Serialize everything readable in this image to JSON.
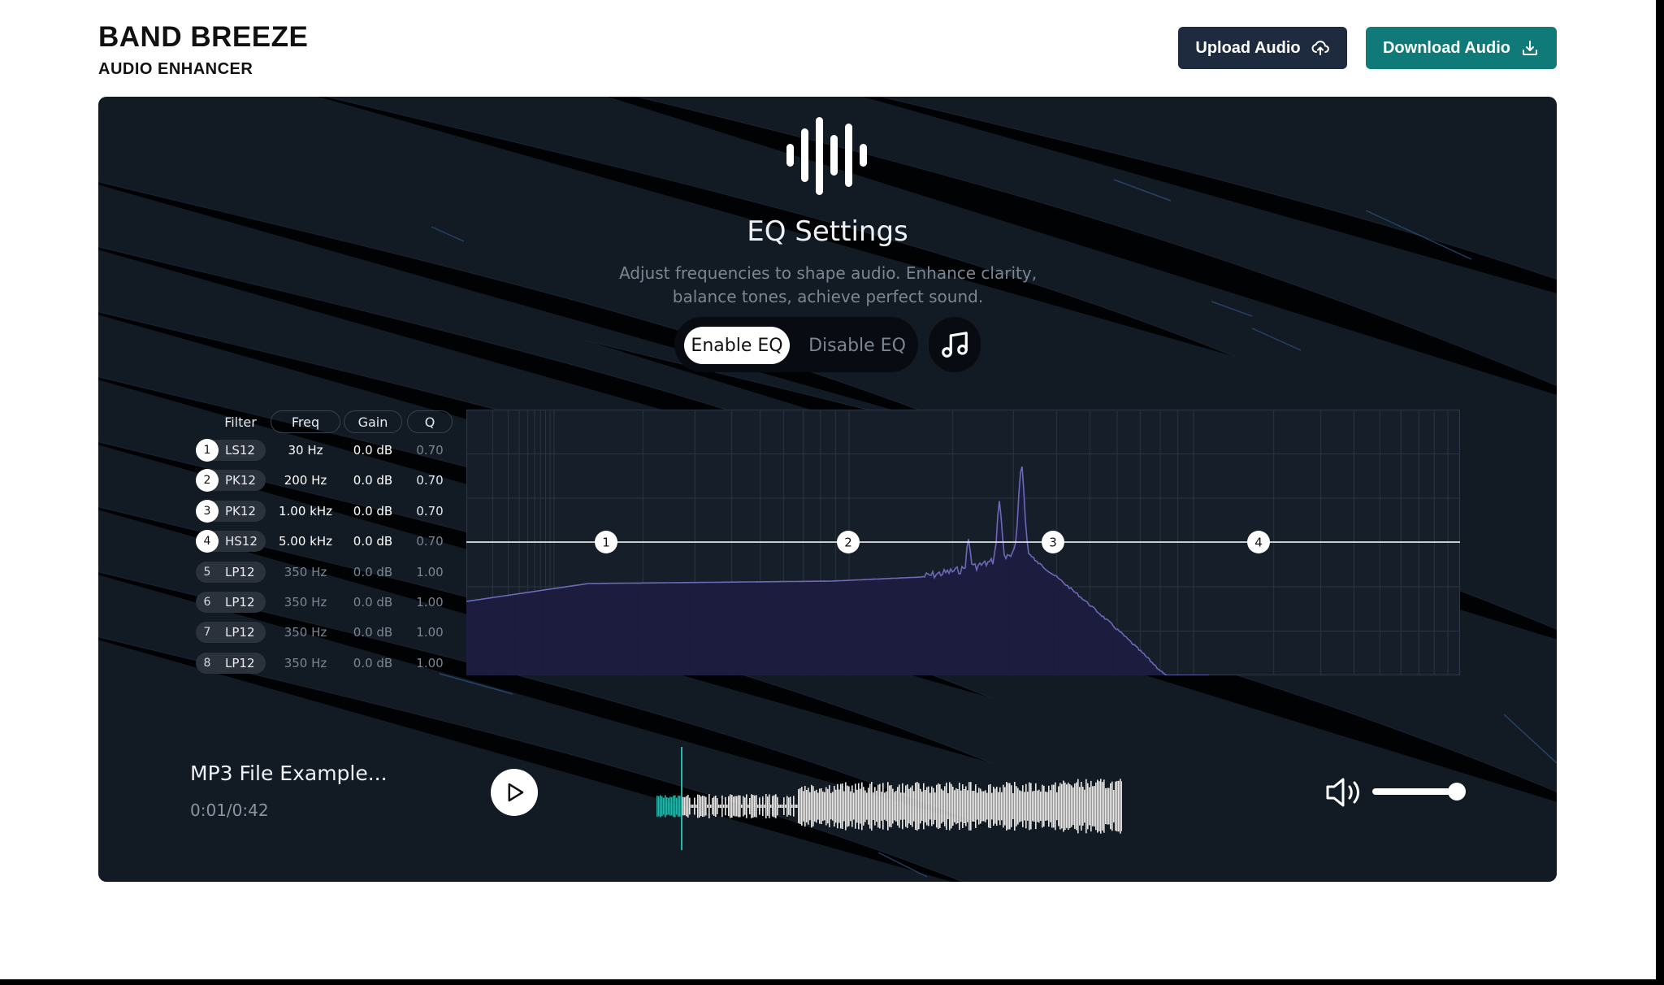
{
  "brand": {
    "title": "BAND BREEZE",
    "subtitle": "AUDIO ENHANCER"
  },
  "header": {
    "upload_label": "Upload Audio",
    "upload_icon": "cloud-upload-icon",
    "download_label": "Download Audio",
    "download_icon": "download-icon"
  },
  "eq": {
    "logo_icon": "soundwave-icon",
    "title": "EQ Settings",
    "description": "Adjust frequencies to shape audio. Enhance clarity, balance tones, achieve perfect sound.",
    "enable_label": "Enable EQ",
    "disable_label": "Disable EQ",
    "selected": "Enable EQ",
    "music_icon": "music-note-icon"
  },
  "filters": {
    "headers": {
      "filter": "Filter",
      "freq": "Freq",
      "gain": "Gain",
      "q": "Q"
    },
    "rows": [
      {
        "num": "1",
        "type": "LS12",
        "freq": "30 Hz",
        "gain": "0.0 dB",
        "q": "0.70",
        "active": true
      },
      {
        "num": "2",
        "type": "PK12",
        "freq": "200 Hz",
        "gain": "0.0 dB",
        "q": "0.70",
        "active": true
      },
      {
        "num": "3",
        "type": "PK12",
        "freq": "1.00 kHz",
        "gain": "0.0 dB",
        "q": "0.70",
        "active": true
      },
      {
        "num": "4",
        "type": "HS12",
        "freq": "5.00 kHz",
        "gain": "0.0 dB",
        "q": "0.70",
        "active": true
      },
      {
        "num": "5",
        "type": "LP12",
        "freq": "350 Hz",
        "gain": "0.0 dB",
        "q": "1.00",
        "active": false
      },
      {
        "num": "6",
        "type": "LP12",
        "freq": "350 Hz",
        "gain": "0.0 dB",
        "q": "1.00",
        "active": false
      },
      {
        "num": "7",
        "type": "LP12",
        "freq": "350 Hz",
        "gain": "0.0 dB",
        "q": "1.00",
        "active": false
      },
      {
        "num": "8",
        "type": "LP12",
        "freq": "350 Hz",
        "gain": "0.0 dB",
        "q": "1.00",
        "active": false
      }
    ]
  },
  "graph": {
    "nodes": [
      "1",
      "2",
      "3",
      "4"
    ]
  },
  "player": {
    "title": "MP3 File Example...",
    "time": "0:01/0:42",
    "play_icon": "play-icon",
    "volume_icon": "volume-icon",
    "progress_fraction": 0.024,
    "volume_fraction": 0.9,
    "played_color": "#2bb3a8",
    "wave_color": "#e8e8e8"
  },
  "colors": {
    "panel_bg": "#121a24",
    "upload_bg": "#1e2b3f",
    "download_bg": "#0f7a78",
    "accent": "#2bb3a8"
  }
}
